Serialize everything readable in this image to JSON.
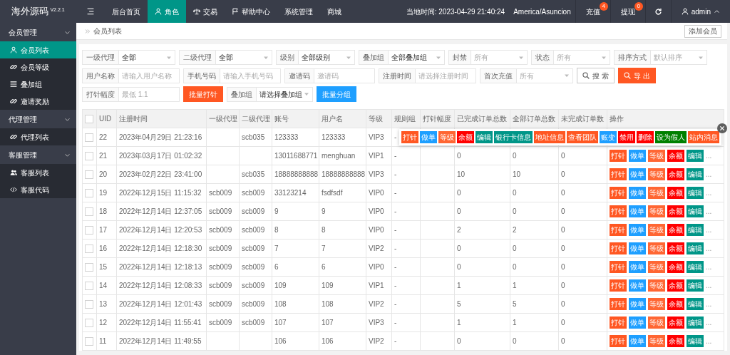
{
  "app": {
    "logo": "海外源码",
    "version": "V2.2.1"
  },
  "top_nav": {
    "items": [
      {
        "label": "后台首页",
        "kind": "plain",
        "selected": false
      },
      {
        "label": "角色",
        "kind": "user",
        "selected": true
      },
      {
        "label": "交易",
        "kind": "scale",
        "selected": false
      },
      {
        "label": "帮助中心",
        "kind": "flag",
        "selected": false
      },
      {
        "label": "系统管理",
        "kind": "plain",
        "selected": false
      },
      {
        "label": "商城",
        "kind": "plain",
        "selected": false
      }
    ]
  },
  "top_right": {
    "clock": "当地时间: 2023-04-29 21:40:24",
    "timezone": "America/Asuncion",
    "links": [
      {
        "label": "充值",
        "badge": "4"
      },
      {
        "label": "提现",
        "badge": "0"
      }
    ],
    "user": "admin"
  },
  "sidebar": {
    "groups": [
      {
        "label": "会员管理",
        "expanded": true,
        "children": [
          {
            "label": "会员列表",
            "kind": "user",
            "selected": true
          },
          {
            "label": "会员等级",
            "kind": "link",
            "selected": false
          },
          {
            "label": "叠加组",
            "kind": "list",
            "selected": false
          },
          {
            "label": "邀请奖励",
            "kind": "link",
            "selected": false
          }
        ]
      },
      {
        "label": "代理管理",
        "expanded": true,
        "children": [
          {
            "label": "代理列表",
            "kind": "link",
            "selected": false
          }
        ]
      },
      {
        "label": "客服管理",
        "expanded": true,
        "children": [
          {
            "label": "客服列表",
            "kind": "users",
            "selected": false
          },
          {
            "label": "客服代码",
            "kind": "code",
            "selected": false
          }
        ]
      }
    ]
  },
  "breadcrumb": "会员列表",
  "add_button": "添加会员",
  "filters": [
    [
      {
        "kind": "select",
        "label": "一级代理",
        "value": "全部"
      },
      {
        "kind": "select",
        "label": "二级代理",
        "value": "全部"
      },
      {
        "kind": "select",
        "label": "级别",
        "value": "全部级别"
      },
      {
        "kind": "select",
        "label": "叠加组",
        "value": "全部叠加组"
      },
      {
        "kind": "select",
        "label": "封禁",
        "placeholder": "所有"
      },
      {
        "kind": "select",
        "label": "状态",
        "placeholder": "所有"
      },
      {
        "kind": "select",
        "label": "排序方式",
        "placeholder": "默认排序"
      }
    ],
    [
      {
        "kind": "input",
        "label": "用户名称",
        "placeholder": "请输入用户名称"
      },
      {
        "kind": "input",
        "label": "手机号码",
        "placeholder": "请输入手机号码"
      },
      {
        "kind": "input",
        "label": "邀请码",
        "placeholder": "邀请码"
      },
      {
        "kind": "input",
        "label": "注册时间",
        "placeholder": "请选择注册时间"
      },
      {
        "kind": "select",
        "label": "首次充值",
        "placeholder": "所有"
      },
      {
        "kind": "search_button",
        "label": "搜 索"
      },
      {
        "kind": "export_button",
        "label": "导 出",
        "color": "#ff5722"
      }
    ],
    [
      {
        "kind": "input",
        "label": "打针幅度",
        "placeholder": "最低 1.1"
      },
      {
        "kind": "button",
        "label": "批量打针",
        "color": "#ff5722"
      },
      {
        "kind": "select",
        "label": "叠加组",
        "value": "请选择叠加组"
      },
      {
        "kind": "button",
        "label": "批量分组",
        "color": "#1e9fff"
      }
    ]
  ],
  "table": {
    "header_checked": false,
    "columns": [
      "UID",
      "注册时间",
      "一级代理",
      "二级代理",
      "账号",
      "用户名",
      "等级",
      "规则组",
      "打针幅度",
      "已完成订单总数",
      "全部订单总数",
      "未完成订单数",
      "操作"
    ],
    "rows": [
      {
        "checked": false,
        "uid": "22",
        "reg_time": "2023年04月29日 21:23:16",
        "agent_2": "scb035",
        "account": "123333",
        "username": "123333",
        "level": "VIP3",
        "rule_group": "-"
      },
      {
        "checked": false,
        "uid": "21",
        "reg_time": "2023年03月17日 01:02:32",
        "account": "13011688771",
        "username": "menghuan",
        "level": "VIP1",
        "rule_group": "-",
        "completed": "0",
        "total": "0",
        "incomplete": "0",
        "actions": [
          {
            "label": "打针",
            "color": "#ff5722"
          },
          {
            "label": "做单",
            "color": "#1e9fff"
          },
          {
            "label": "等级",
            "color": "#ff6633"
          },
          {
            "label": "余额",
            "color": "#ff0000"
          },
          {
            "label": "编辑",
            "color": "#009688"
          }
        ],
        "more": "..."
      },
      {
        "checked": false,
        "uid": "20",
        "reg_time": "2023年02月22日 23:41:00",
        "agent_2": "scb035",
        "account": "18888888888",
        "username": "18888888888",
        "level": "VIP3",
        "rule_group": "-",
        "completed": "10",
        "total": "10",
        "incomplete": "0",
        "actions": [
          {
            "label": "打针",
            "color": "#ff5722"
          },
          {
            "label": "做单",
            "color": "#1e9fff"
          },
          {
            "label": "等级",
            "color": "#ff6633"
          },
          {
            "label": "余额",
            "color": "#ff0000"
          },
          {
            "label": "编辑",
            "color": "#009688"
          }
        ],
        "more": "..."
      },
      {
        "checked": false,
        "uid": "19",
        "reg_time": "2022年12月15日 11:15:32",
        "agent_1": "scb009",
        "agent_2": "scb009",
        "account": "33123214",
        "username": "fsdfsdf",
        "level": "VIP0",
        "rule_group": "-",
        "completed": "0",
        "total": "0",
        "incomplete": "0",
        "actions": [
          {
            "label": "打针",
            "color": "#ff5722"
          },
          {
            "label": "做单",
            "color": "#1e9fff"
          },
          {
            "label": "等级",
            "color": "#ff6633"
          },
          {
            "label": "余额",
            "color": "#ff0000"
          },
          {
            "label": "编辑",
            "color": "#009688"
          }
        ],
        "more": "..."
      },
      {
        "checked": false,
        "uid": "18",
        "reg_time": "2022年12月14日 12:37:05",
        "agent_1": "scb009",
        "agent_2": "scb009",
        "account": "9",
        "username": "9",
        "level": "VIP0",
        "rule_group": "-",
        "completed": "0",
        "total": "0",
        "incomplete": "0",
        "actions": [
          {
            "label": "打针",
            "color": "#ff5722"
          },
          {
            "label": "做单",
            "color": "#1e9fff"
          },
          {
            "label": "等级",
            "color": "#ff6633"
          },
          {
            "label": "余额",
            "color": "#ff0000"
          },
          {
            "label": "编辑",
            "color": "#009688"
          }
        ],
        "more": "..."
      },
      {
        "checked": false,
        "uid": "17",
        "reg_time": "2022年12月14日 12:20:53",
        "agent_1": "scb009",
        "agent_2": "scb009",
        "account": "8",
        "username": "8",
        "level": "VIP0",
        "rule_group": "-",
        "completed": "2",
        "total": "2",
        "incomplete": "0",
        "actions": [
          {
            "label": "打针",
            "color": "#ff5722"
          },
          {
            "label": "做单",
            "color": "#1e9fff"
          },
          {
            "label": "等级",
            "color": "#ff6633"
          },
          {
            "label": "余额",
            "color": "#ff0000"
          },
          {
            "label": "编辑",
            "color": "#009688"
          }
        ],
        "more": "..."
      },
      {
        "checked": false,
        "uid": "16",
        "reg_time": "2022年12月14日 12:18:30",
        "agent_1": "scb009",
        "agent_2": "scb009",
        "account": "7",
        "username": "7",
        "level": "VIP2",
        "rule_group": "-",
        "completed": "0",
        "total": "0",
        "incomplete": "0",
        "actions": [
          {
            "label": "打针",
            "color": "#ff5722"
          },
          {
            "label": "做单",
            "color": "#1e9fff"
          },
          {
            "label": "等级",
            "color": "#ff6633"
          },
          {
            "label": "余额",
            "color": "#ff0000"
          },
          {
            "label": "编辑",
            "color": "#009688"
          }
        ],
        "more": "..."
      },
      {
        "checked": false,
        "uid": "15",
        "reg_time": "2022年12月14日 12:18:13",
        "agent_1": "scb009",
        "agent_2": "scb009",
        "account": "6",
        "username": "6",
        "level": "VIP0",
        "rule_group": "-",
        "completed": "0",
        "total": "0",
        "incomplete": "0",
        "actions": [
          {
            "label": "打针",
            "color": "#ff5722"
          },
          {
            "label": "做单",
            "color": "#1e9fff"
          },
          {
            "label": "等级",
            "color": "#ff6633"
          },
          {
            "label": "余额",
            "color": "#ff0000"
          },
          {
            "label": "编辑",
            "color": "#009688"
          }
        ],
        "more": "..."
      },
      {
        "checked": false,
        "uid": "14",
        "reg_time": "2022年12月14日 12:08:33",
        "agent_1": "scb009",
        "agent_2": "scb009",
        "account": "109",
        "username": "109",
        "level": "VIP1",
        "rule_group": "-",
        "completed": "1",
        "total": "1",
        "incomplete": "0",
        "actions": [
          {
            "label": "打针",
            "color": "#ff5722"
          },
          {
            "label": "做单",
            "color": "#1e9fff"
          },
          {
            "label": "等级",
            "color": "#ff6633"
          },
          {
            "label": "余额",
            "color": "#ff0000"
          },
          {
            "label": "编辑",
            "color": "#009688"
          }
        ],
        "more": "..."
      },
      {
        "checked": false,
        "uid": "13",
        "reg_time": "2022年12月14日 12:01:43",
        "agent_1": "scb009",
        "agent_2": "scb009",
        "account": "108",
        "username": "108",
        "level": "VIP2",
        "rule_group": "-",
        "completed": "5",
        "total": "5",
        "incomplete": "0",
        "actions": [
          {
            "label": "打针",
            "color": "#ff5722"
          },
          {
            "label": "做单",
            "color": "#1e9fff"
          },
          {
            "label": "等级",
            "color": "#ff6633"
          },
          {
            "label": "余额",
            "color": "#ff0000"
          },
          {
            "label": "编辑",
            "color": "#009688"
          }
        ],
        "more": "..."
      },
      {
        "checked": false,
        "uid": "12",
        "reg_time": "2022年12月14日 11:55:41",
        "agent_1": "scb009",
        "agent_2": "scb009",
        "account": "107",
        "username": "107",
        "level": "VIP3",
        "rule_group": "-",
        "completed": "1",
        "total": "1",
        "incomplete": "0",
        "actions": [
          {
            "label": "打针",
            "color": "#ff5722"
          },
          {
            "label": "做单",
            "color": "#1e9fff"
          },
          {
            "label": "等级",
            "color": "#ff6633"
          },
          {
            "label": "余额",
            "color": "#ff0000"
          },
          {
            "label": "编辑",
            "color": "#009688"
          }
        ],
        "more": "..."
      },
      {
        "checked": false,
        "uid": "11",
        "reg_time": "2022年12月14日 11:49:55",
        "account": "106",
        "username": "106",
        "level": "VIP2",
        "rule_group": "-",
        "completed": "0",
        "total": "0",
        "incomplete": "0",
        "actions": [
          {
            "label": "打针",
            "color": "#ff5722"
          },
          {
            "label": "做单",
            "color": "#1e9fff"
          },
          {
            "label": "等级",
            "color": "#ff6633"
          },
          {
            "label": "余额",
            "color": "#ff0000"
          },
          {
            "label": "编辑",
            "color": "#009688"
          }
        ],
        "more": "..."
      }
    ],
    "popup": {
      "actions": [
        {
          "label": "打针",
          "color": "#ff5722"
        },
        {
          "label": "做单",
          "color": "#1e9fff"
        },
        {
          "label": "等级",
          "color": "#ff6633"
        },
        {
          "label": "余额",
          "color": "#ff0000"
        },
        {
          "label": "编辑",
          "color": "#009688"
        },
        {
          "label": "银行卡信息",
          "color": "#009688"
        },
        {
          "label": "地址信息",
          "color": "#ff5722"
        },
        {
          "label": "查看团队",
          "color": "#ff5722"
        },
        {
          "label": "账变",
          "color": "#1e9fff"
        },
        {
          "label": "禁用",
          "color": "#ff0000"
        },
        {
          "label": "删除",
          "color": "#ff0000"
        },
        {
          "label": "设为假人",
          "color": "#008000"
        },
        {
          "label": "站内消息",
          "color": "#ff5722"
        }
      ]
    }
  }
}
